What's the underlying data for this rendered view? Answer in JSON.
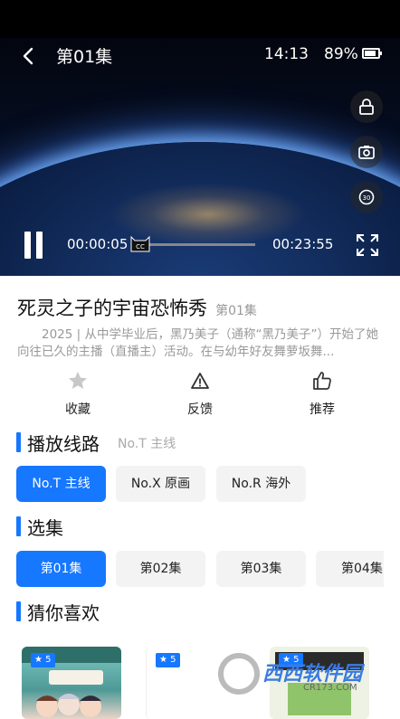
{
  "player": {
    "episode_title": "第01集",
    "clock": "14:13",
    "battery": "89%",
    "battery_level": 0.89,
    "time_current": "00:00:05",
    "time_total": "00:23:55",
    "progress": 0.0035
  },
  "show": {
    "title": "死灵之子的宇宙恐怖秀",
    "episode": "第01集",
    "description": "2025 | 从中学毕业后，黑乃美子（通称“黑乃美子”）开始了她向往已久的主播（直播主）活动。在与幼年好友舞萝坂舞..."
  },
  "actions": [
    {
      "label": "收藏",
      "icon": "star-icon"
    },
    {
      "label": "反馈",
      "icon": "warning-icon"
    },
    {
      "label": "推荐",
      "icon": "thumbs-up-icon"
    }
  ],
  "lines": {
    "heading": "播放线路",
    "current": "No.T 主线",
    "options": [
      "No.T 主线",
      "No.X 原画",
      "No.R 海外"
    ]
  },
  "episodes": {
    "heading": "选集",
    "items": [
      "第01集",
      "第02集",
      "第03集",
      "第04集"
    ]
  },
  "recommend": {
    "heading": "猜你喜欢",
    "items": [
      {
        "badge": "5"
      },
      {
        "badge": "5"
      },
      {
        "badge": "5"
      }
    ]
  },
  "watermark": {
    "brand": "西西软件园",
    "url": "CR173.COM"
  },
  "colors": {
    "accent": "#1677ff"
  }
}
